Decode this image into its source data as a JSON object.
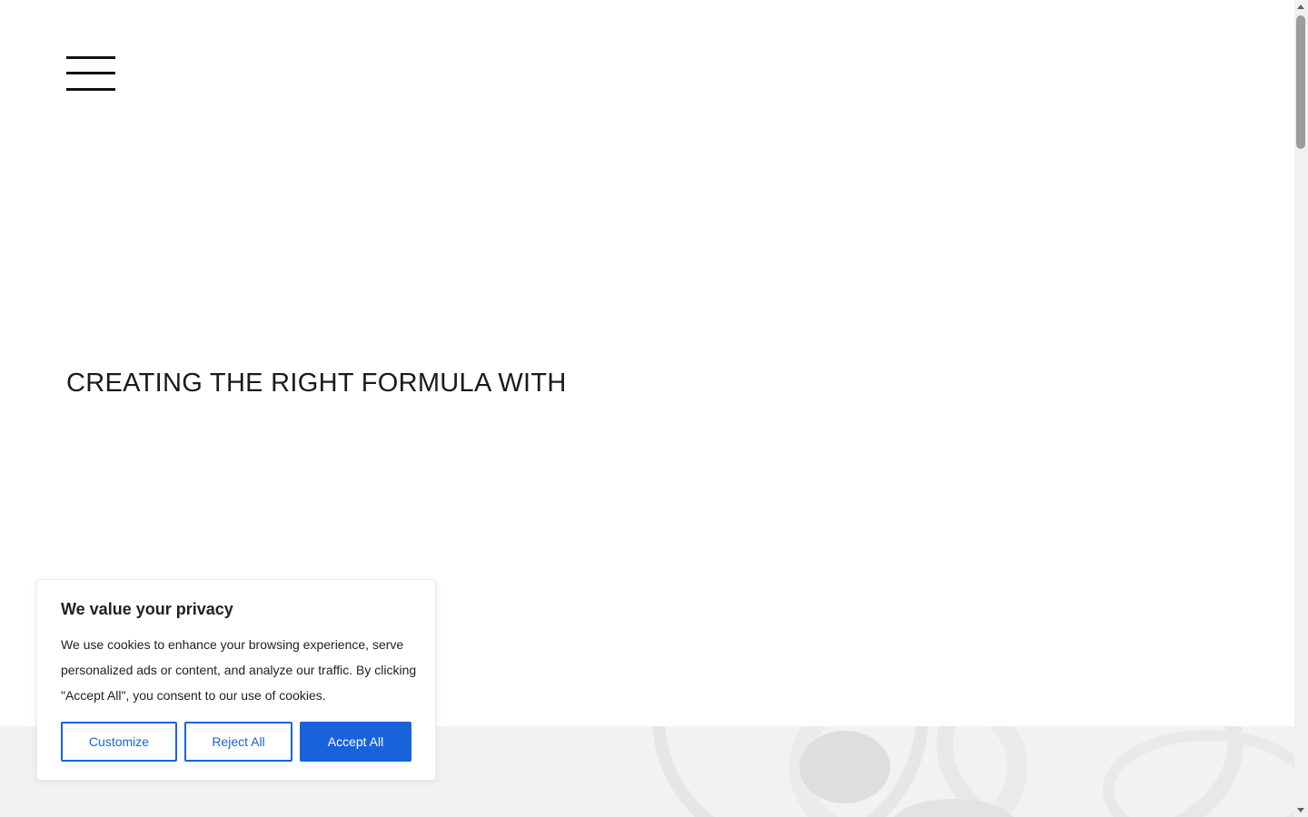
{
  "header": {
    "menu_icon": "hamburger-menu-icon"
  },
  "hero": {
    "title": "CREATING THE RIGHT FORMULA WITH"
  },
  "cookie_banner": {
    "title": "We value your privacy",
    "text": "We use cookies to enhance your browsing experience, serve personalized ads or content, and analyze our traffic. By clicking \"Accept All\", you consent to our use of cookies.",
    "customize_label": "Customize",
    "reject_label": "Reject All",
    "accept_label": "Accept All",
    "accent_color": "#1863dc"
  },
  "colors": {
    "background": "#ffffff",
    "band": "#f2f2f2",
    "text": "#1a1a1a"
  }
}
